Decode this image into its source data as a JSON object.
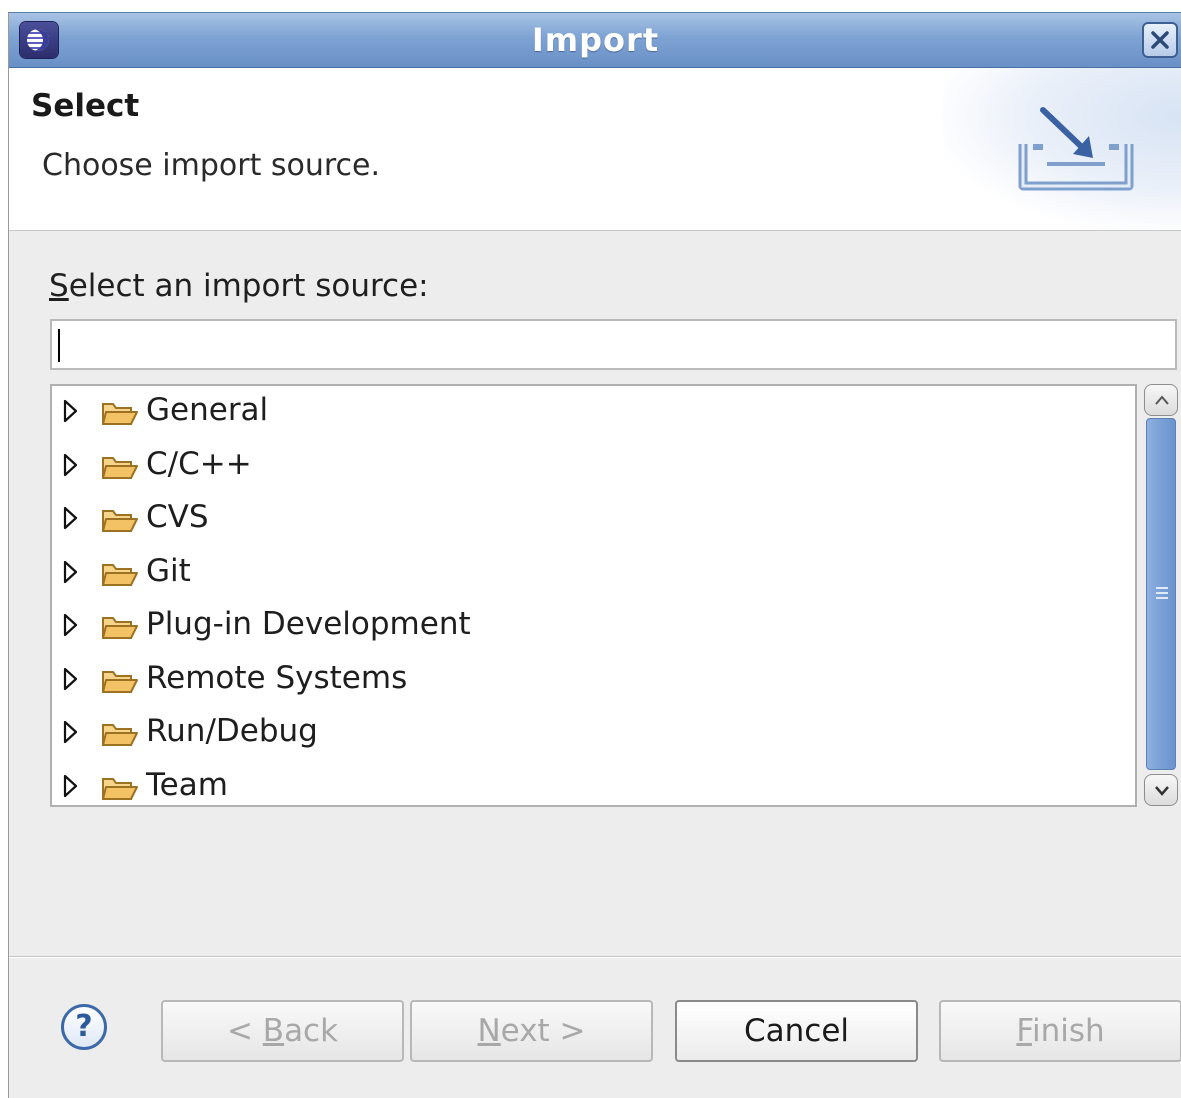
{
  "window": {
    "title": "Import",
    "app_icon": "eclipse-icon",
    "close_icon": "close-icon"
  },
  "banner": {
    "title": "Select",
    "description": "Choose import source.",
    "icon": "import-wizard-icon"
  },
  "source": {
    "label_mnemonic": "S",
    "label_rest": "elect an import source:",
    "filter_value": "",
    "filter_placeholder": ""
  },
  "tree": {
    "items": [
      {
        "label": "General",
        "icon": "folder-icon",
        "expanded": false
      },
      {
        "label": "C/C++",
        "icon": "folder-icon",
        "expanded": false
      },
      {
        "label": "CVS",
        "icon": "folder-icon",
        "expanded": false
      },
      {
        "label": "Git",
        "icon": "folder-icon",
        "expanded": false
      },
      {
        "label": "Plug-in Development",
        "icon": "folder-icon",
        "expanded": false
      },
      {
        "label": "Remote Systems",
        "icon": "folder-icon",
        "expanded": false
      },
      {
        "label": "Run/Debug",
        "icon": "folder-icon",
        "expanded": false
      },
      {
        "label": "Team",
        "icon": "folder-icon",
        "expanded": false
      }
    ]
  },
  "buttons": {
    "help": "?",
    "back_prefix": "< ",
    "back_mnemonic": "B",
    "back_rest": "ack",
    "next_mnemonic": "N",
    "next_rest": "ext >",
    "cancel": "Cancel",
    "finish_mnemonic": "F",
    "finish_rest": "inish",
    "back_enabled": false,
    "next_enabled": false,
    "cancel_enabled": true,
    "finish_enabled": false
  },
  "colors": {
    "titlebar": "#7ea3d3",
    "accent": "#6b93cd",
    "folder": "#f2c264"
  }
}
